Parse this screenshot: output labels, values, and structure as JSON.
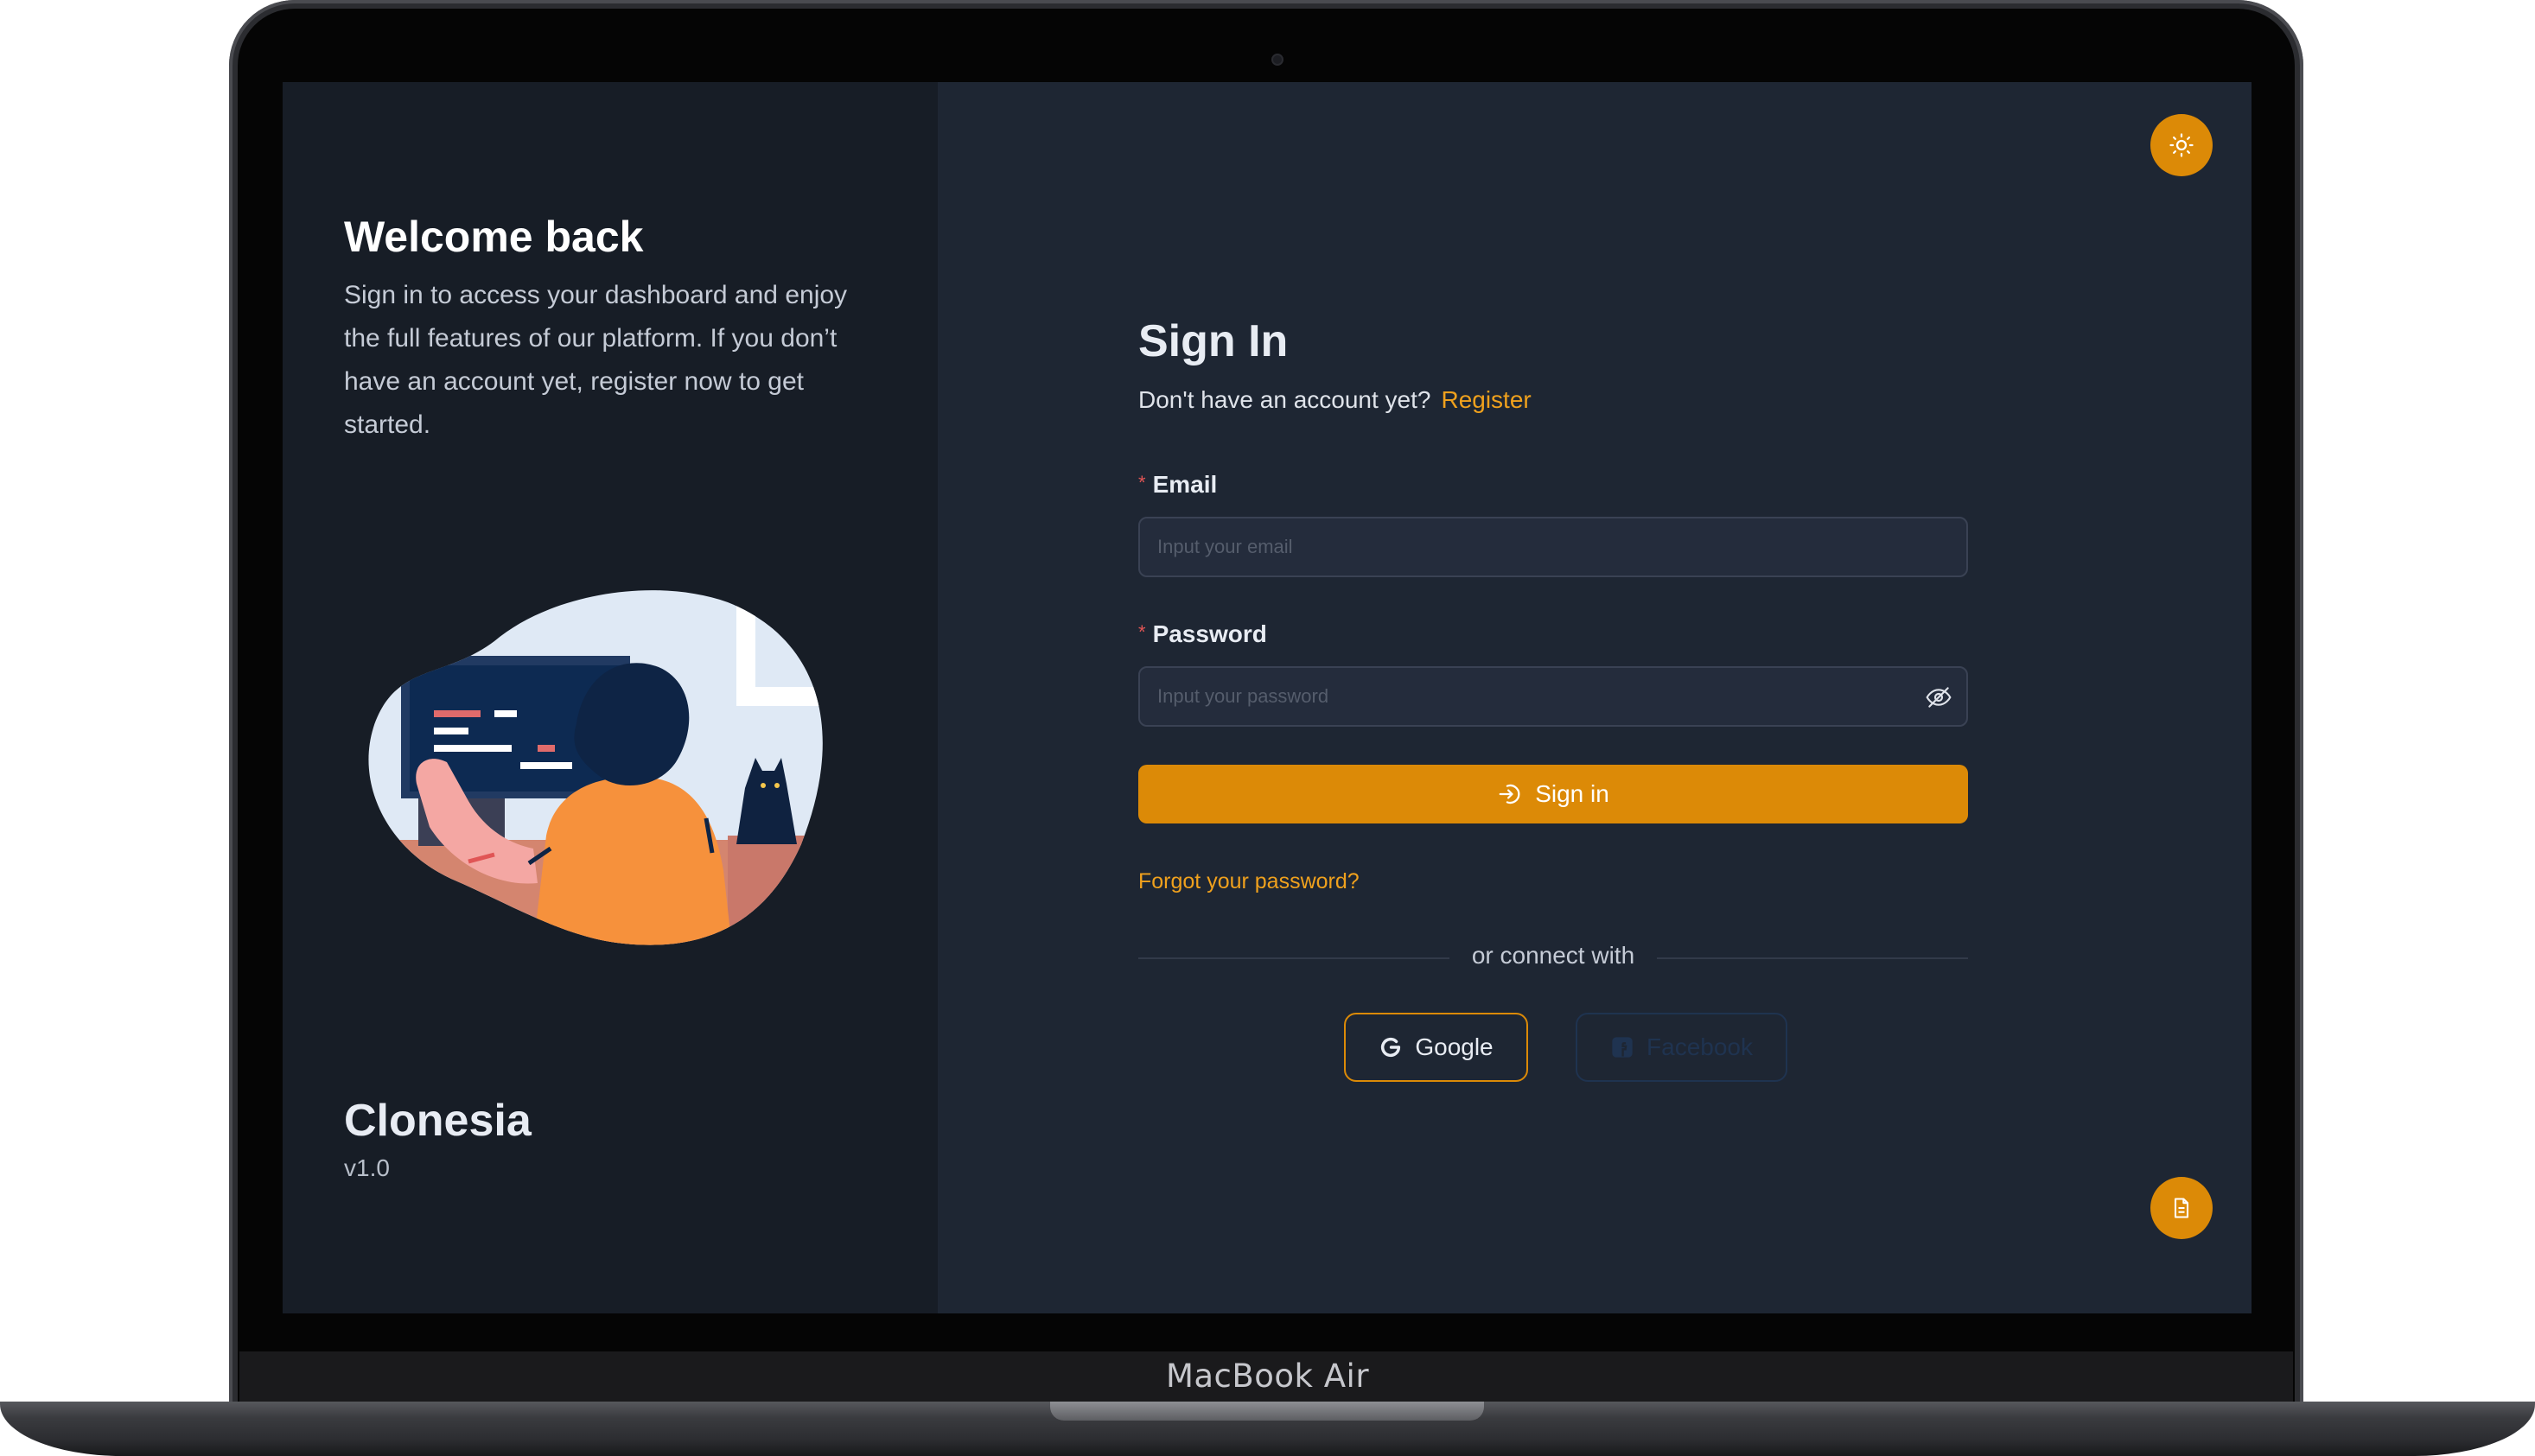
{
  "device": {
    "label": "MacBook Air"
  },
  "left_panel": {
    "title": "Welcome back",
    "description": "Sign in to access your dashboard and enjoy the full features of our platform. If you don’t have an account yet, register now to get started.",
    "app_name": "Clonesia",
    "version": "v1.0"
  },
  "signin": {
    "title": "Sign In",
    "no_account_text": "Don't have an account yet?",
    "register_link": "Register",
    "email_label": "Email",
    "email_placeholder": "Input your email",
    "password_label": "Password",
    "password_placeholder": "Input your password",
    "submit_label": "Sign in",
    "forgot_link": "Forgot your password?",
    "divider_text": "or connect with",
    "google_label": "Google",
    "facebook_label": "Facebook"
  },
  "icons": {
    "theme_toggle": "sun-icon",
    "password_visibility": "eye-off-icon",
    "submit": "login-icon",
    "floating_action": "document-icon",
    "google": "google-icon",
    "facebook": "facebook-icon"
  },
  "colors": {
    "accent": "#dc8a07",
    "link": "#f0a11d",
    "required_marker": "#e25555",
    "left_panel_bg": "#171d26",
    "right_panel_bg": "#1e2633",
    "input_bg": "#242c3c"
  }
}
